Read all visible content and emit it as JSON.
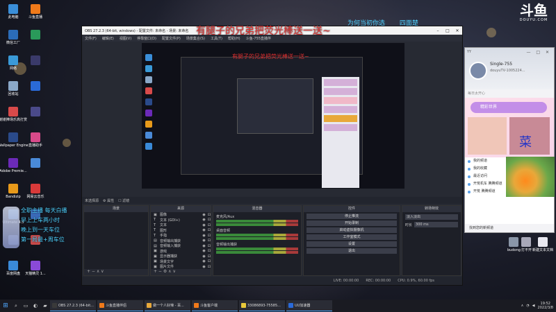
{
  "desktop": {
    "left_icons": [
      {
        "label": "此电脑",
        "color": "#3a8ed8"
      },
      {
        "label": "微信工厂",
        "color": "#2b6cb8"
      },
      {
        "label": "网络",
        "color": "#3a9ad8"
      },
      {
        "label": "回收站",
        "color": "#8aa8c8"
      },
      {
        "label": "谢谢捧场乐高打赏",
        "color": "#d84a4a"
      },
      {
        "label": "Wallpaper Engine",
        "color": "#2a4a8a"
      },
      {
        "label": "Adobe Premie...",
        "color": "#6b2ab8"
      },
      {
        "label": "Bandizip",
        "color": "#e89a1a"
      },
      {
        "label": "Ultimate 4.5",
        "color": "#4a8ad8"
      },
      {
        "label": "",
        "color": "#6a7aa8"
      },
      {
        "label": "百度网盘",
        "color": "#3a8ad8"
      }
    ],
    "col2_icons": [
      {
        "label": "斗鱼直播",
        "color": "#f07a1a"
      },
      {
        "label": "",
        "color": "#2a9a5a"
      },
      {
        "label": "",
        "color": "#3a3a6a"
      },
      {
        "label": "",
        "color": "#2a6ad8"
      },
      {
        "label": "",
        "color": "#4a4a8a"
      },
      {
        "label": "直播助手",
        "color": "#d84a8a"
      },
      {
        "label": "",
        "color": "#4a8ad8"
      },
      {
        "label": "网易云音乐",
        "color": "#d83a3a"
      },
      {
        "label": "",
        "color": "#3a6ab8"
      },
      {
        "label": "",
        "color": "#c84a4a"
      },
      {
        "label": "天猫精灵 1...",
        "color": "#8a4ad8"
      }
    ],
    "right_icons": [
      {
        "label": "budong",
        "color": "#8a96a8"
      },
      {
        "label": "打不开",
        "color": "#a8a8b8"
      },
      {
        "label": "新建文本文档",
        "color": "#e8e8f0"
      }
    ]
  },
  "overlay": {
    "banner": "有腿子的兄弟把荧光棒送一送~",
    "top_tip": "为何当初你选____ 四面楚",
    "nested_banner": "有腿子的兄弟把荧光棒送一送~",
    "chat_lines": [
      "全职主播 每天白播",
      "早上上车两小时",
      "晚上到一天车位",
      "第一局最+周车位"
    ]
  },
  "douyu": {
    "mark": "斗鱼",
    "sub": "DOUYU.COM"
  },
  "obs": {
    "title": "OBS 27.2.3 (64-bit, windows) - 配置文件: 未命名 - 场景: 未命名",
    "window_buttons": [
      "–",
      "□",
      "✕"
    ],
    "menu": [
      "文件(F)",
      "编辑(E)",
      "视图(V)",
      "停靠窗口(D)",
      "配置文件(P)",
      "场景集合(S)",
      "工具(T)",
      "帮助(H)",
      "斗鱼-755直播伴"
    ],
    "toolbar": [
      "未选择源",
      "⚙ 属性",
      "☐ 滤镜"
    ],
    "docks": {
      "scenes": {
        "title": "场景",
        "foot": "+ − ∧ ∨"
      },
      "sources": {
        "title": "来源",
        "foot": "+ − ⚙ ∧ ∨",
        "items": [
          {
            "icon": "▣",
            "name": "图像"
          },
          {
            "icon": "T",
            "name": "文本 (GDI+)"
          },
          {
            "icon": "T",
            "name": "文本"
          },
          {
            "icon": "T",
            "name": "图形"
          },
          {
            "icon": "T",
            "name": "手指"
          },
          {
            "icon": "▤",
            "name": "音频输出捕获"
          },
          {
            "icon": "▤",
            "name": "音频输入捕获"
          },
          {
            "icon": "▣",
            "name": "游戏"
          },
          {
            "icon": "▣",
            "name": "显示器捕获"
          },
          {
            "icon": "▣",
            "name": "场景文字"
          },
          {
            "icon": "▣",
            "name": "图片文件"
          }
        ]
      },
      "mixer": {
        "title": "混音器",
        "rows": [
          {
            "name": "麦克风/Aux"
          },
          {
            "name": "桌面音频"
          },
          {
            "name": "音频输出捕获"
          }
        ]
      },
      "controls": {
        "title": "控件",
        "buttons": [
          "停止推流",
          "开始录制",
          "启动虚拟摄像机",
          "工作室模式",
          "设置",
          "退出"
        ]
      },
      "transitions": {
        "title": "转场特效",
        "type_value": "淡入淡出",
        "duration_label": "时长",
        "duration_value": "300 ms"
      }
    },
    "status": [
      "LIVE: 00:00:00",
      "REC: 00:00:00",
      "CPU: 0.9%, 60.00 fps"
    ]
  },
  "qq": {
    "yy_label": "YY",
    "window_controls": "—  □  ✕",
    "name": "Single-755",
    "sign": "douyuTV-1005224...",
    "weather": "每日太开心",
    "ad_title": "精彩世界",
    "ad_kanji": "菜",
    "list": [
      "我的频道",
      "我的收藏",
      "最近访问",
      "开荒机车 腾腾频道",
      "开荒 腾腾频道"
    ],
    "foot": "找到您的新频道"
  },
  "taskbar": {
    "start_icon": "⊞",
    "apps": [
      {
        "label": "OBS 27.2.3 (64-bit...",
        "color": "#3a3a3a"
      },
      {
        "label": "斗鱼直播伴侣",
        "color": "#f07a1a"
      },
      {
        "label": "做一个人好辣 - 百...",
        "color": "#e8a83a"
      },
      {
        "label": "斗鱼客户端",
        "color": "#f07a1a"
      },
      {
        "label": "33086893-75585...",
        "color": "#e8c83a"
      },
      {
        "label": "UU加速器",
        "color": "#2a6ad8"
      }
    ],
    "time": "19:52",
    "date": "2022/3/8"
  }
}
